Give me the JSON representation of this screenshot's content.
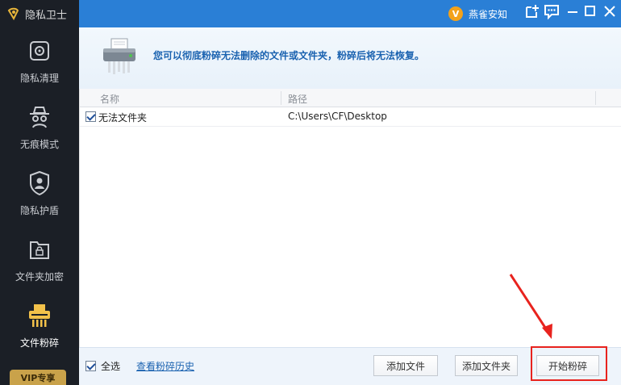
{
  "app": {
    "title": "隐私卫士",
    "vip_label": "VIP专享"
  },
  "sidebar": {
    "items": [
      {
        "label": "隐私清理",
        "icon": "privacy-clean-icon"
      },
      {
        "label": "无痕模式",
        "icon": "spy-incognito-icon"
      },
      {
        "label": "隐私护盾",
        "icon": "shield-user-icon"
      },
      {
        "label": "文件夹加密",
        "icon": "folder-lock-icon"
      },
      {
        "label": "文件粉碎",
        "icon": "shredder-icon",
        "active": true
      }
    ]
  },
  "topbar": {
    "user_name": "燕雀安知",
    "avatar_letter": "V"
  },
  "banner": {
    "message": "您可以彻底粉碎无法删除的文件或文件夹，粉碎后将无法恢复。"
  },
  "table": {
    "columns": [
      "名称",
      "路径"
    ],
    "rows": [
      {
        "name": "无法文件夹",
        "path": "C:\\Users\\CF\\Desktop",
        "checked": true
      }
    ]
  },
  "footer": {
    "select_all_label": "全选",
    "history_link": "查看粉碎历史",
    "add_file_button": "添加文件",
    "add_folder_button": "添加文件夹",
    "start_button": "开始粉碎"
  },
  "colors": {
    "accent_blue": "#2a7fd6",
    "sidebar_bg": "#1b1f26",
    "highlight_red": "#e8231e",
    "vip_gold": "#c9a24a"
  }
}
